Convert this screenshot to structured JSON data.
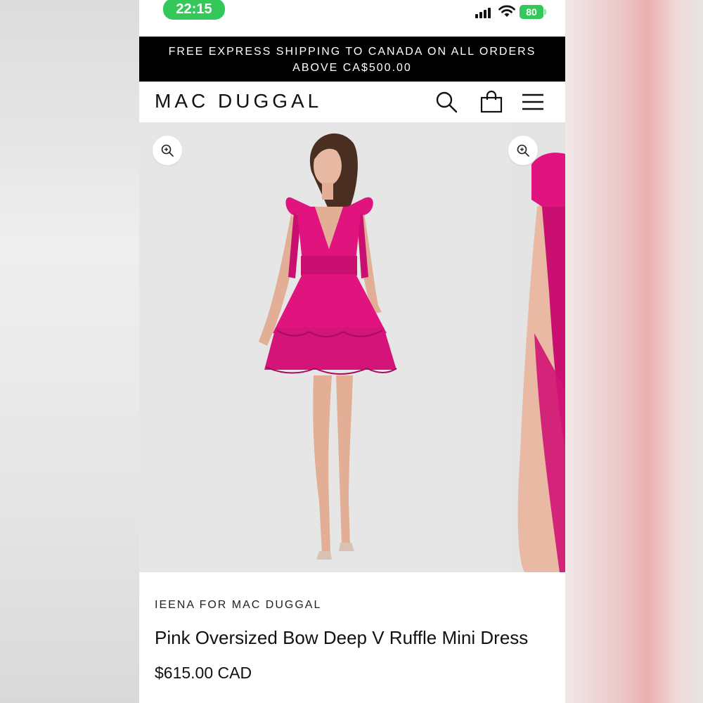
{
  "status_bar": {
    "time": "22:15",
    "battery": "80"
  },
  "promo": {
    "text": "FREE EXPRESS SHIPPING TO CANADA ON ALL ORDERS ABOVE CA$500.00"
  },
  "header": {
    "logo": "MAC DUGGAL",
    "icons": [
      "search-icon",
      "shopping-bag-icon",
      "hamburger-menu-icon"
    ]
  },
  "gallery": {
    "zoom_icon": "zoom-in-icon"
  },
  "product": {
    "brand": "IEENA FOR MAC DUGGAL",
    "title": "Pink Oversized Bow Deep V Ruffle Mini Dress",
    "price": "$615.00 CAD"
  },
  "colors": {
    "accent_green": "#34c759",
    "dress_pink": "#e0137f",
    "banner_black": "#000000"
  }
}
